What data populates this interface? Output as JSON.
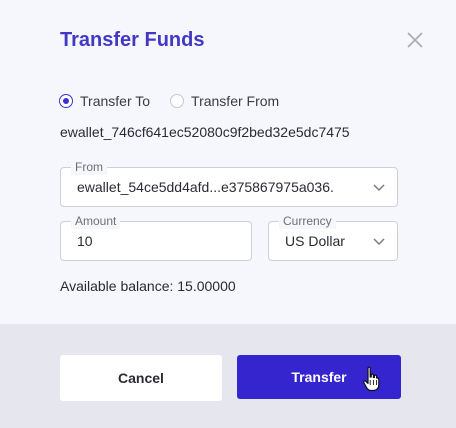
{
  "dialog": {
    "title": "Transfer Funds",
    "close_icon": "close-icon"
  },
  "direction": {
    "options": [
      {
        "label": "Transfer To",
        "checked": true
      },
      {
        "label": "Transfer From",
        "checked": false
      }
    ]
  },
  "target_wallet": "ewallet_746cf641ec52080c9f2bed32e5dc7475",
  "from_field": {
    "legend": "From",
    "value": "ewallet_54ce5dd4afd...e375867975a036."
  },
  "amount_field": {
    "legend": "Amount",
    "value": "10"
  },
  "currency_field": {
    "legend": "Currency",
    "value": "US Dollar"
  },
  "balance": {
    "text": "Available balance: 15.00000"
  },
  "buttons": {
    "cancel": "Cancel",
    "transfer": "Transfer"
  },
  "colors": {
    "accent": "#3425cf",
    "title": "#4338c4"
  }
}
